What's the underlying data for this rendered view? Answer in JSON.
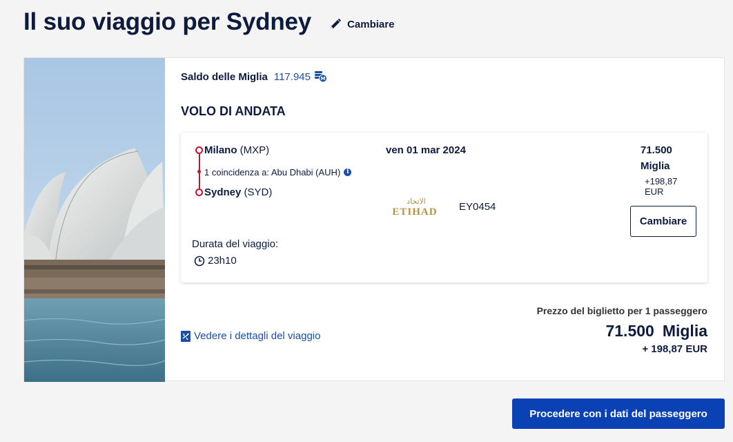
{
  "header": {
    "title": "Il suo viaggio per Sydney",
    "change_label": "Cambiare"
  },
  "balance": {
    "label": "Saldo delle Miglia",
    "value": "117.945"
  },
  "section_title": "VOLO DI ANDATA",
  "flight": {
    "origin_city": "Milano",
    "origin_code": "(MXP)",
    "connection": "1 coincidenza a: Abu Dhabi (AUH)",
    "destination_city": "Sydney",
    "destination_code": "(SYD)",
    "date": "ven 01 mar 2024",
    "airline_name": "ETIHAD",
    "airline_arabic": "الاتحاد",
    "flight_number": "EY0454",
    "duration_label": "Durata del viaggio:",
    "duration_value": "23h10",
    "fare_miles": "71.500",
    "fare_miles_label": "Miglia",
    "fare_eur": "+198,87 EUR",
    "change_button": "Cambiare"
  },
  "details_link": "Vedere i dettagli del viaggio",
  "price_summary": {
    "caption": "Prezzo del biglietto per 1 passeggero",
    "miles": "71.500",
    "miles_label": "Miglia",
    "eur": "+ 198,87 EUR"
  },
  "proceed_button": "Procedere con i dati del passeggero",
  "colors": {
    "primary": "#0a42b5",
    "link": "#1a4fa8",
    "route": "#c8102e",
    "airline_gold": "#b8923a",
    "text": "#0e1b3d"
  }
}
